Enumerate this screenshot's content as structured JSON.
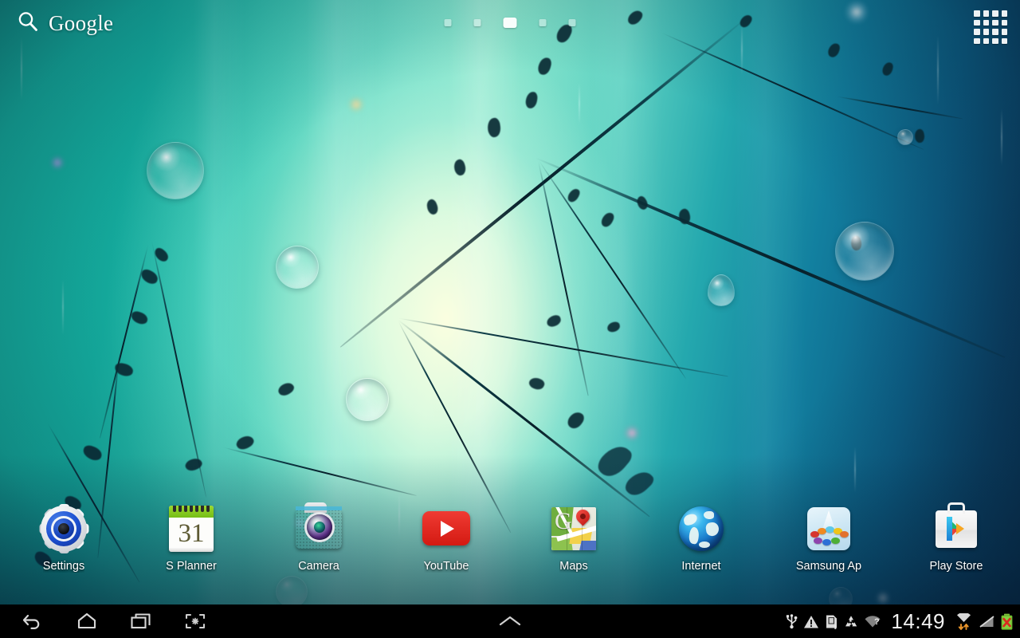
{
  "device": {
    "platform": "Android tablet home screen"
  },
  "search_widget": {
    "label": "Google",
    "icon": "search-icon",
    "placeholder": "Google"
  },
  "page_indicator": {
    "total": 5,
    "active_index": 2
  },
  "apps_button": {
    "icon": "apps-grid-icon",
    "rows": 4,
    "cols": 4
  },
  "dock": {
    "apps": [
      {
        "label": "Settings",
        "icon": "settings-gear-icon"
      },
      {
        "label": "S Planner",
        "icon": "calendar-icon",
        "day": "31"
      },
      {
        "label": "Camera",
        "icon": "camera-icon"
      },
      {
        "label": "YouTube",
        "icon": "youtube-icon"
      },
      {
        "label": "Maps",
        "icon": "maps-icon",
        "glyph": "G"
      },
      {
        "label": "Internet",
        "icon": "globe-icon"
      },
      {
        "label": "Samsung Ap",
        "icon": "samsung-apps-icon"
      },
      {
        "label": "Play Store",
        "icon": "play-store-icon"
      }
    ]
  },
  "navbar": {
    "buttons": [
      {
        "name": "back",
        "icon": "back-arrow-icon"
      },
      {
        "name": "home",
        "icon": "home-icon"
      },
      {
        "name": "recents",
        "icon": "recent-apps-icon"
      },
      {
        "name": "screenshot",
        "icon": "screen-capture-icon"
      }
    ],
    "center": {
      "name": "expand",
      "icon": "chevron-up-icon"
    }
  },
  "status_bar": {
    "time": "14:49",
    "icons": [
      {
        "name": "usb-icon",
        "label": "USB connected"
      },
      {
        "name": "warning-icon",
        "label": "Warning"
      },
      {
        "name": "sd-card-icon",
        "label": "SD card"
      },
      {
        "name": "recycle-icon",
        "label": "Recycle"
      },
      {
        "name": "wifi-unknown-icon",
        "label": "Wi-Fi unknown"
      },
      {
        "name": "wifi-transfer-icon",
        "label": "Wi-Fi data transfer"
      },
      {
        "name": "signal-off-icon",
        "label": "No signal"
      },
      {
        "name": "battery-error-icon",
        "label": "Battery error"
      }
    ]
  },
  "wallpaper": {
    "description": "Teal to navy gradient with backlit plant stems, water droplets and rain streaks",
    "colors": {
      "teal": "#17b5a2",
      "mint_glow": "#eaffe4",
      "deep_blue": "#0a2f4f",
      "stem_dark": "#071f29"
    }
  }
}
